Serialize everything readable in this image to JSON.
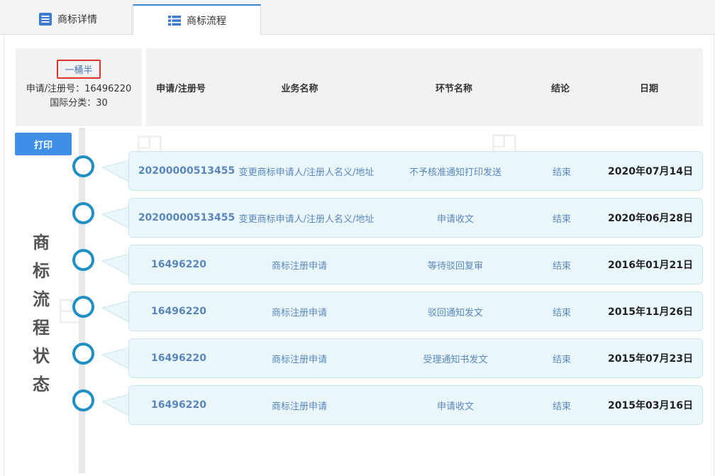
{
  "tabs": [
    {
      "label": "商标详情"
    },
    {
      "label": "商标流程"
    }
  ],
  "info": {
    "mark_name": "一桶半",
    "reg_line": "申请/注册号：16496220",
    "class_line": "国际分类：30"
  },
  "headers": {
    "reg": "申请/注册号",
    "business": "业务名称",
    "step": "环节名称",
    "result": "结论",
    "date": "日期"
  },
  "print_label": "打印",
  "side_title": [
    "商",
    "标",
    "流",
    "程",
    "状",
    "态"
  ],
  "rows": [
    {
      "reg": "20200000513455",
      "business": "变更商标申请人/注册人名义/地址",
      "step": "不予核准通知打印发送",
      "result": "结束",
      "date": "2020年07月14日"
    },
    {
      "reg": "20200000513455",
      "business": "变更商标申请人/注册人名义/地址",
      "step": "申请收文",
      "result": "结束",
      "date": "2020年06月28日"
    },
    {
      "reg": "16496220",
      "business": "商标注册申请",
      "step": "等待驳回复审",
      "result": "结束",
      "date": "2016年01月21日"
    },
    {
      "reg": "16496220",
      "business": "商标注册申请",
      "step": "驳回通知发文",
      "result": "结束",
      "date": "2015年11月26日"
    },
    {
      "reg": "16496220",
      "business": "商标注册申请",
      "step": "受理通知书发文",
      "result": "结束",
      "date": "2015年07月23日"
    },
    {
      "reg": "16496220",
      "business": "商标注册申请",
      "step": "申请收文",
      "result": "结束",
      "date": "2015年03月16日"
    }
  ],
  "icons": {
    "detail_tab": "document-list-icon",
    "flow_tab": "table-list-icon",
    "timeline_node": "circle-node-icon"
  },
  "colors": {
    "accent": "#3f8fe6",
    "node": "#1f8fc4",
    "row_bg": "#eaf7fa",
    "link_text": "#5a86bd",
    "highlight_border": "#e0322b"
  }
}
